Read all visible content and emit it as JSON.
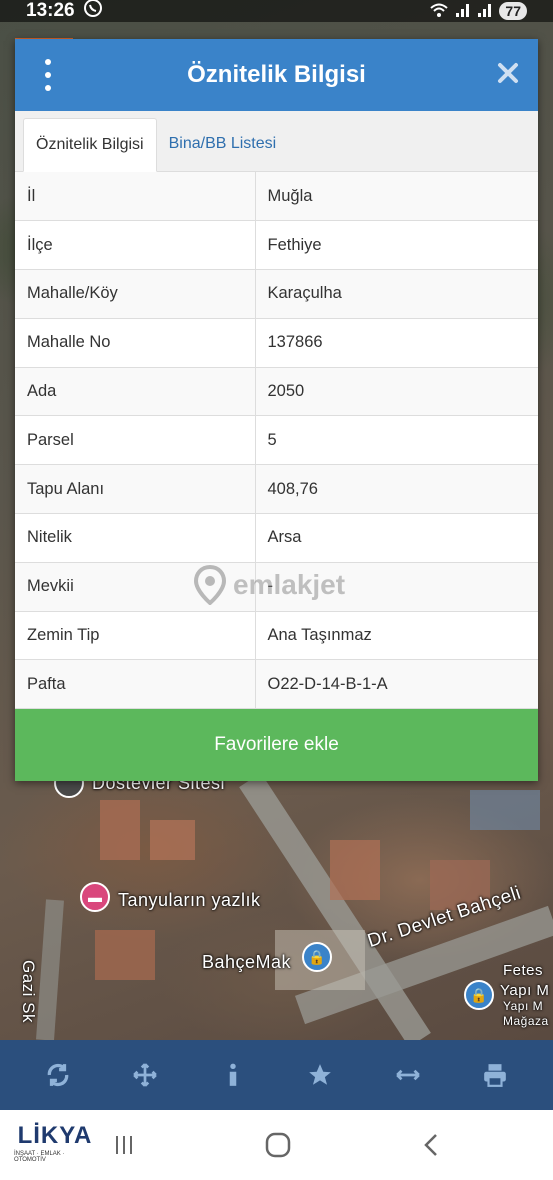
{
  "status_bar": {
    "time": "13:26",
    "battery": "77"
  },
  "dialog": {
    "title": "Öznitelik Bilgisi",
    "tabs": [
      {
        "label": "Öznitelik Bilgisi",
        "active": true
      },
      {
        "label": "Bina/BB Listesi",
        "active": false
      }
    ],
    "rows": [
      {
        "key": "İl",
        "value": "Muğla"
      },
      {
        "key": "İlçe",
        "value": "Fethiye"
      },
      {
        "key": "Mahalle/Köy",
        "value": "Karaçulha"
      },
      {
        "key": "Mahalle No",
        "value": "137866"
      },
      {
        "key": "Ada",
        "value": "2050"
      },
      {
        "key": "Parsel",
        "value": "5"
      },
      {
        "key": "Tapu Alanı",
        "value": "408,76"
      },
      {
        "key": "Nitelik",
        "value": "Arsa"
      },
      {
        "key": "Mevkii",
        "value": "-"
      },
      {
        "key": "Zemin Tip",
        "value": "Ana Taşınmaz"
      },
      {
        "key": "Pafta",
        "value": "O22-D-14-B-1-A"
      }
    ],
    "favorite_button": "Favorilere ekle",
    "header_color": "#3a83c9",
    "button_color": "#5cb85c"
  },
  "watermark": "emlakjet",
  "map": {
    "labels": {
      "dostevler": "Dostevler Sitesi",
      "tanyularin": "Tanyuların yazlık",
      "bahcemak": "BahçeMak",
      "devlet": "Dr. Devlet Bahçeli",
      "gazi": "Gazi Sk",
      "fetes": "Fetes",
      "yapi": "Yapı M",
      "yapi2": "Yapı M",
      "magaza": "Mağaza"
    }
  },
  "toolbar": {
    "icons": [
      "refresh-icon",
      "move-icon",
      "info-icon",
      "star-icon",
      "measure-icon",
      "print-icon"
    ]
  },
  "nav": {
    "logo_main": "LİKYA",
    "logo_sub": "İNŞAAT · EMLAK · OTOMOTİV"
  }
}
